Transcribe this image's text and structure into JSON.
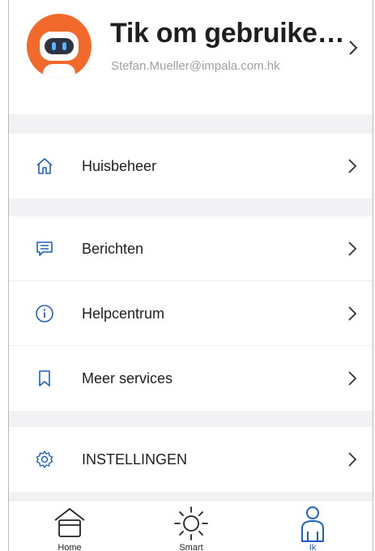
{
  "profile": {
    "username": "Tik om gebruikersnaam in te stellen",
    "email": "Stefan.Mueller@impala.com.hk"
  },
  "menu": {
    "home_management": "Huisbeheer",
    "messages": "Berichten",
    "help_center": "Helpcentrum",
    "more_services": "Meer services",
    "settings": "INSTELLINGEN"
  },
  "tabbar": {
    "home": "Home",
    "smart": "Smart",
    "me": "Ik"
  },
  "colors": {
    "accent": "#1f5fbf",
    "avatar_bg": "#f26a2b",
    "background": "#f2f2f4"
  },
  "icons": {
    "home_management": "house-icon",
    "messages": "message-icon",
    "help_center": "info-icon",
    "more_services": "bookmark-icon",
    "settings": "gear-icon"
  }
}
